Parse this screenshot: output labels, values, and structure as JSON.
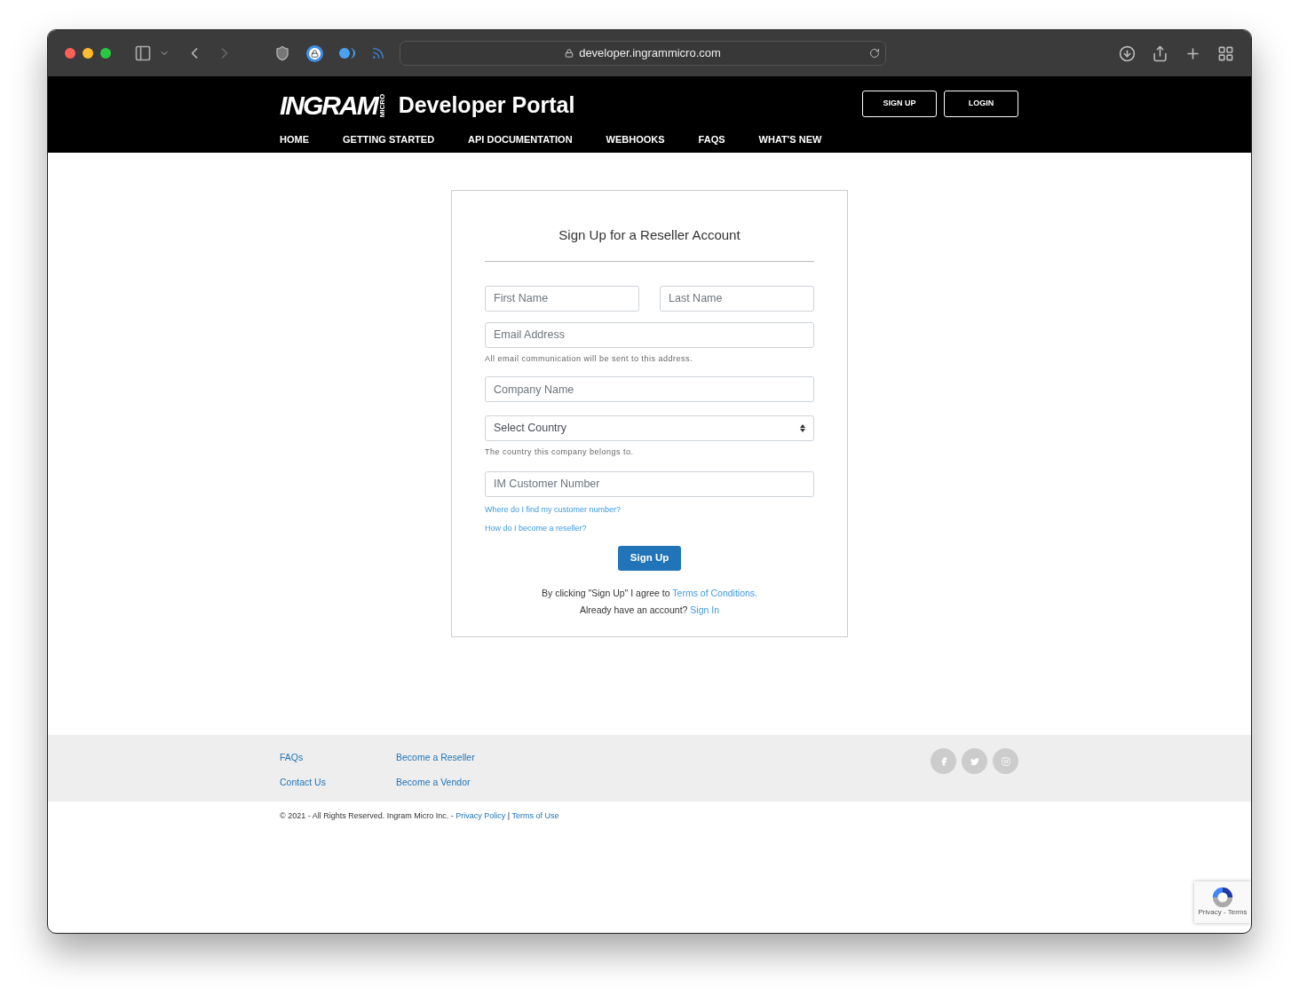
{
  "browser": {
    "url": "developer.ingrammicro.com"
  },
  "header": {
    "logo_word": "INGRAM",
    "logo_sub": "MICRO",
    "title": "Developer Portal",
    "buttons": [
      "SIGN UP",
      "LOGIN"
    ],
    "nav": [
      {
        "label": "HOME",
        "selected": false
      },
      {
        "label": "GETTING STARTED",
        "selected": false
      },
      {
        "label": "API DOCUMENTATION",
        "selected": false
      },
      {
        "label": "WEBHOOKS",
        "selected": false
      },
      {
        "label": "FAQS",
        "selected": false
      },
      {
        "label": "WHAT'S NEW",
        "selected": false
      }
    ]
  },
  "form": {
    "title": "Sign Up for a Reseller Account",
    "first_name": {
      "placeholder": "First Name"
    },
    "last_name": {
      "placeholder": "Last Name"
    },
    "email": {
      "placeholder": "Email Address",
      "help": "All email communication will be sent to this address."
    },
    "company": {
      "placeholder": "Company Name"
    },
    "country": {
      "value": "Select Country",
      "help": "The country this company belongs to."
    },
    "customer_number": {
      "placeholder": "IM Customer Number"
    },
    "help_links": [
      "Where do I find my customer number?",
      "How do I become a reseller?"
    ],
    "submit": "Sign Up",
    "terms_text": "By clicking \"Sign Up\" I agree to",
    "terms_link": "Terms of Conditions.",
    "signin_text": "Already have an account?",
    "signin_link": "Sign In"
  },
  "footer": {
    "links": [
      "FAQs",
      "Become a Reseller",
      "Contact Us",
      "Become a Vendor"
    ],
    "social": [
      {
        "kind": "facebook"
      },
      {
        "kind": "twitter"
      },
      {
        "kind": "instagram"
      }
    ],
    "copyright": "© 2021 - All Rights Reserved. Ingram Micro Inc. -",
    "privacy": "Privacy Policy",
    "separator": "|",
    "terms": "Terms of Use"
  },
  "recaptcha": {
    "label": "Privacy - Terms"
  }
}
